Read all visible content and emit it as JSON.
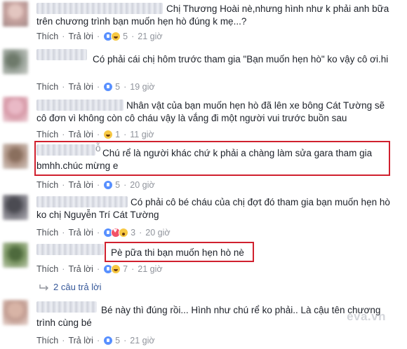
{
  "labels": {
    "like": "Thích",
    "reply": "Trả lời",
    "dot": "·"
  },
  "comments": [
    {
      "text": "Chị Thương Hoài nè,nhưng hình như k phải anh bữa trên chương trình bạn muốn hẹn hò đúng k mẹ...?",
      "reactions": [
        "like",
        "haha"
      ],
      "count": "5",
      "time": "21 giờ"
    },
    {
      "text": "Có phải cái chị hôm trước tham gia \"Bạn muốn hẹn hò\" ko vậy cô ơi.hi",
      "reactions": [
        "like"
      ],
      "count": "5",
      "time": "19 giờ"
    },
    {
      "text": "Nhân vật của bạn muốn hẹn hò đã lên xe bông Cát Tường sẽ cô đơn vì không còn cô cháu vậy là vắng đi một người vui trước buồn sau",
      "reactions": [
        "haha"
      ],
      "count": "1",
      "time": "11 giờ"
    },
    {
      "text": "Chú rể là người khác chứ k phải a chàng làm sửa gara tham gia bmhh.chúc mừng e",
      "name_suffix": "ỗ",
      "reactions": [
        "like"
      ],
      "count": "5",
      "time": "20 giờ"
    },
    {
      "text": "Có phải cô bé cháu của chị đợt đó tham gia bạn muốn hẹn hò ko chị Nguyễn Trí Cát Tường",
      "reactions": [
        "like",
        "love",
        "wow"
      ],
      "count": "3",
      "time": "20 giờ"
    },
    {
      "text": "Pè pữa thi bạn muốn hẹn hò nè",
      "reactions": [
        "like",
        "haha"
      ],
      "count": "7",
      "time": "21 giờ"
    },
    {
      "text": "Bé này thì đúng rồi... Hình như chú rể ko phải.. Là cậu tên chương trình cùng bé",
      "reactions": [
        "like"
      ],
      "count": "5",
      "time": "21 giờ"
    }
  ],
  "replies": {
    "label": "2 câu trả lời"
  },
  "watermark": "eva.vn",
  "colors": {
    "highlight": "#d0202e",
    "link": "#365899",
    "meta": "#90949c"
  }
}
